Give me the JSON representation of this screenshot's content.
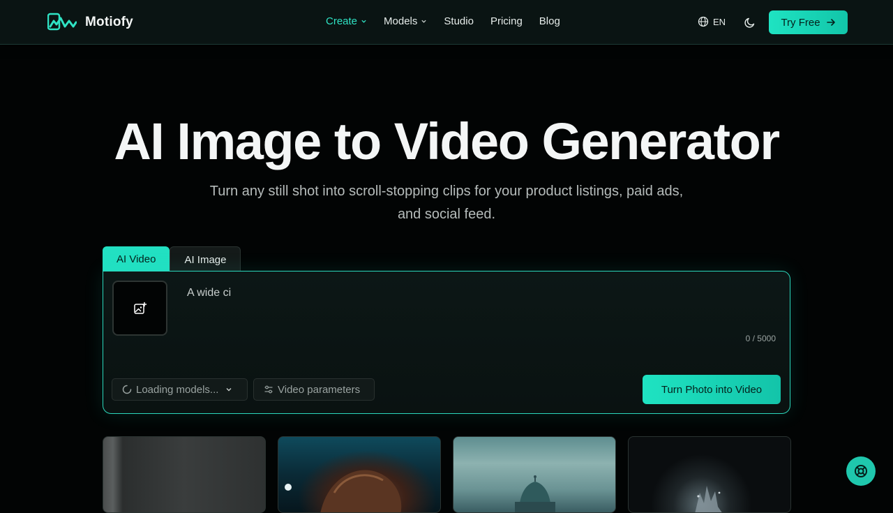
{
  "brand": {
    "name": "Motiofy"
  },
  "nav": {
    "items": [
      {
        "label": "Create",
        "has_dropdown": true,
        "active": true
      },
      {
        "label": "Models",
        "has_dropdown": true,
        "active": false
      },
      {
        "label": "Studio",
        "has_dropdown": false,
        "active": false
      },
      {
        "label": "Pricing",
        "has_dropdown": false,
        "active": false
      },
      {
        "label": "Blog",
        "has_dropdown": false,
        "active": false
      }
    ],
    "language": "EN",
    "cta_label": "Try Free"
  },
  "hero": {
    "title": "AI Image to Video Generator",
    "subtitle": "Turn any still shot into scroll-stopping clips for your product listings, paid ads, and social feed."
  },
  "generator": {
    "tabs": [
      {
        "label": "AI Video",
        "active": true
      },
      {
        "label": "AI Image",
        "active": false
      }
    ],
    "prompt_value": "A wide ci",
    "char_count": "0 / 5000",
    "model_select_label": "Loading models...",
    "params_label": "Video parameters",
    "submit_label": "Turn Photo into Video"
  },
  "colors": {
    "accent": "#22e0c2",
    "background": "#020404",
    "nav_background": "#0a1413"
  },
  "icons": {
    "upload": "image-plus-icon",
    "language": "globe-icon",
    "theme": "moon-icon",
    "cta": "arrow-right-icon",
    "loading": "spinner-icon",
    "params": "sliders-icon",
    "help": "lifebuoy-icon"
  }
}
